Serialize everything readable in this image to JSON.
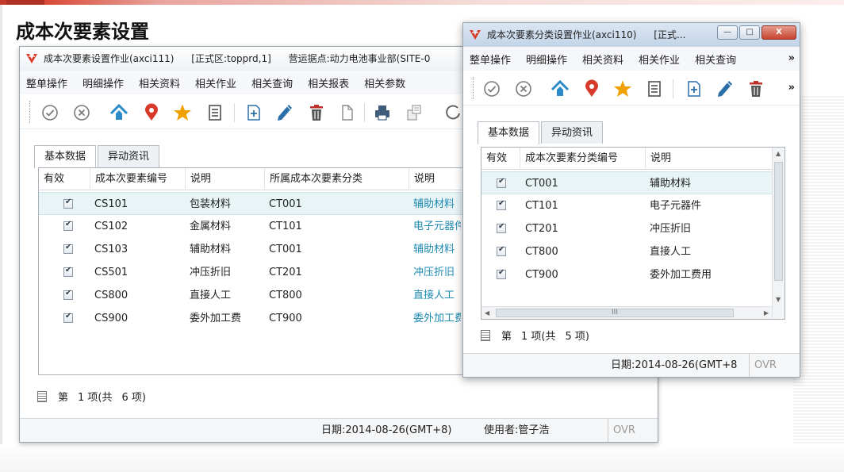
{
  "page": {
    "title": "成本次要素设置"
  },
  "main_window": {
    "title_parts": [
      "成本次要素设置作业(axci111)",
      "[正式区:topprd,1]",
      "营运据点:动力电池事业部(SITE-0"
    ],
    "menu": [
      "整单操作",
      "明细操作",
      "相关资料",
      "相关作业",
      "相关查询",
      "相关报表",
      "相关参数"
    ],
    "tabs": [
      "基本数据",
      "异动资讯"
    ],
    "columns": [
      "有效",
      "成本次要素编号",
      "说明",
      "所属成本次要素分类",
      "说明"
    ],
    "rows": [
      {
        "valid": true,
        "code": "CS101",
        "desc": "包装材料",
        "category": "CT001",
        "category_desc": "辅助材料"
      },
      {
        "valid": true,
        "code": "CS102",
        "desc": "金属材料",
        "category": "CT101",
        "category_desc": "电子元器件"
      },
      {
        "valid": true,
        "code": "CS103",
        "desc": "辅助材料",
        "category": "CT001",
        "category_desc": "辅助材料"
      },
      {
        "valid": true,
        "code": "CS501",
        "desc": "冲压折旧",
        "category": "CT201",
        "category_desc": "冲压折旧"
      },
      {
        "valid": true,
        "code": "CS800",
        "desc": "直接人工",
        "category": "CT800",
        "category_desc": "直接人工"
      },
      {
        "valid": true,
        "code": "CS900",
        "desc": "委外加工费",
        "category": "CT900",
        "category_desc": "委外加工费"
      }
    ],
    "pager": {
      "label": "第",
      "page": "1 项(共",
      "total": "6 项)"
    },
    "status": {
      "date": "日期:2014-08-26(GMT+8)",
      "user": "使用者:管子浩",
      "ovr": "OVR"
    }
  },
  "sub_window": {
    "title": "成本次要素分类设置作业(axci110)",
    "title_extra": "[正式...",
    "controls": {
      "minimize": "—",
      "maximize": "□",
      "close": "X"
    },
    "menu": [
      "整单操作",
      "明细操作",
      "相关资料",
      "相关作业",
      "相关查询"
    ],
    "menu_more": "»",
    "toolbar_more": "»",
    "tabs": [
      "基本数据",
      "异动资讯"
    ],
    "columns": [
      "有效",
      "成本次要素分类编号",
      "说明"
    ],
    "rows": [
      {
        "valid": true,
        "code": "CT001",
        "desc": "辅助材料"
      },
      {
        "valid": true,
        "code": "CT101",
        "desc": "电子元器件"
      },
      {
        "valid": true,
        "code": "CT201",
        "desc": "冲压折旧"
      },
      {
        "valid": true,
        "code": "CT800",
        "desc": "直接人工"
      },
      {
        "valid": true,
        "code": "CT900",
        "desc": "委外加工费用"
      }
    ],
    "pager": {
      "label": "第",
      "page": "1 项(共",
      "total": "5 项)"
    },
    "status": {
      "date": "日期:2014-08-26(GMT+8",
      "ovr": "OVR"
    },
    "hscroll_grip": "III"
  },
  "toolbar_icons": [
    "confirm-icon",
    "cancel-icon",
    "home-icon",
    "location-pin-icon",
    "favorite-star-icon",
    "list-icon",
    "add-icon",
    "edit-pencil-icon",
    "delete-trash-icon",
    "copy-icon",
    "print-icon",
    "export-icon"
  ],
  "colors": {
    "accent_red": "#d83a2a",
    "link": "#1f8ab0",
    "star": "#f0a000",
    "home": "#2a8bc8"
  }
}
